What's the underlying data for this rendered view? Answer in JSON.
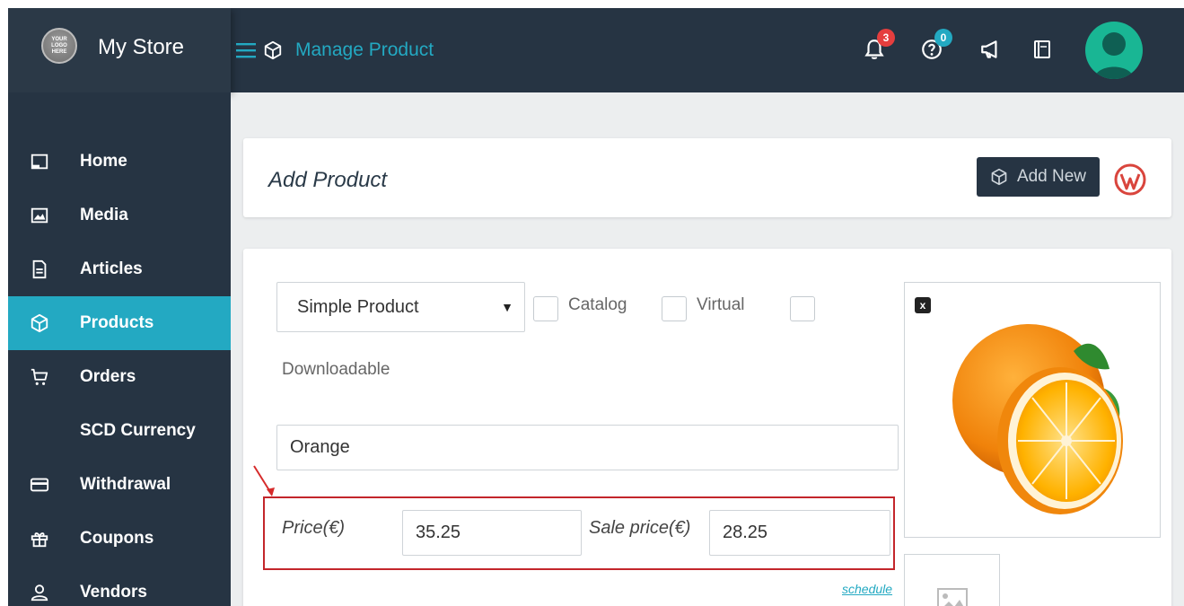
{
  "header": {
    "logo_text": "YOUR LOGO HERE",
    "store_name": "My Store",
    "page_title": "Manage Product",
    "notifications_count": "3",
    "help_count": "0"
  },
  "sidebar": {
    "items": [
      {
        "label": "Home",
        "icon": "monitor-icon",
        "active": false
      },
      {
        "label": "Media",
        "icon": "image-icon",
        "active": false
      },
      {
        "label": "Articles",
        "icon": "document-icon",
        "active": false
      },
      {
        "label": "Products",
        "icon": "cube-icon",
        "active": true
      },
      {
        "label": "Orders",
        "icon": "cart-icon",
        "active": false
      },
      {
        "label": "SCD Currency",
        "icon": "",
        "active": false
      },
      {
        "label": "Withdrawal",
        "icon": "card-icon",
        "active": false
      },
      {
        "label": "Coupons",
        "icon": "gift-icon",
        "active": false
      },
      {
        "label": "Vendors",
        "icon": "user-icon",
        "active": false
      }
    ]
  },
  "content": {
    "card_title": "Add Product",
    "add_new_label": "Add New",
    "product_type": "Simple Product",
    "catalog_label": "Catalog",
    "virtual_label": "Virtual",
    "downloadable_label": "Downloadable",
    "product_name": "Orange",
    "price_label": "Price(€)",
    "price_value": "35.25",
    "sale_price_label": "Sale price(€)",
    "sale_price_value": "28.25",
    "schedule_label": "schedule",
    "remove_image_label": "x"
  },
  "colors": {
    "topbar": "#263443",
    "accent": "#23a9c2",
    "highlight": "#c3262b"
  }
}
